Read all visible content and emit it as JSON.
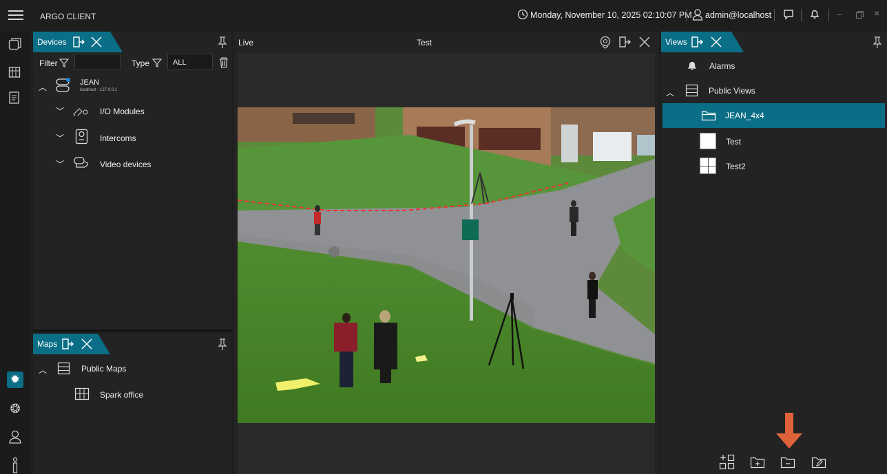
{
  "app": {
    "title": "ARGO CLIENT"
  },
  "titlebar": {
    "datetime": "Monday, November 10, 2025 02:10:07 PM",
    "user": "admin@localhost"
  },
  "devices_panel": {
    "title": "Devices",
    "filter_label": "Filter",
    "filter_value": "",
    "type_label": "Type",
    "type_value": "ALL",
    "server": {
      "name": "JEAN",
      "address": "localhost - 127.0.0.1"
    },
    "groups": [
      {
        "label": "I/O Modules",
        "icon": "io-module-icon"
      },
      {
        "label": "Intercoms",
        "icon": "intercom-icon"
      },
      {
        "label": "Video devices",
        "icon": "video-device-icon"
      }
    ]
  },
  "maps_panel": {
    "title": "Maps",
    "group": "Public Maps",
    "items": [
      {
        "label": "Spark office",
        "icon": "floorplan-icon"
      }
    ]
  },
  "live_panel": {
    "title": "Live",
    "view_name": "Test"
  },
  "views_panel": {
    "title": "Views",
    "alarms_label": "Alarms",
    "group": "Public Views",
    "items": [
      {
        "label": "JEAN_4x4",
        "selected": true,
        "icon": "folder-icon"
      },
      {
        "label": "Test",
        "selected": false,
        "icon": "single-view-icon"
      },
      {
        "label": "Test2",
        "selected": false,
        "icon": "quad-view-icon"
      }
    ],
    "footer_buttons": [
      "add-view-icon",
      "add-folder-icon",
      "folder-icon",
      "edit-folder-icon"
    ]
  },
  "colors": {
    "accent": "#0a6e86",
    "arrow": "#e0623a",
    "background": "#1e1e1e"
  }
}
